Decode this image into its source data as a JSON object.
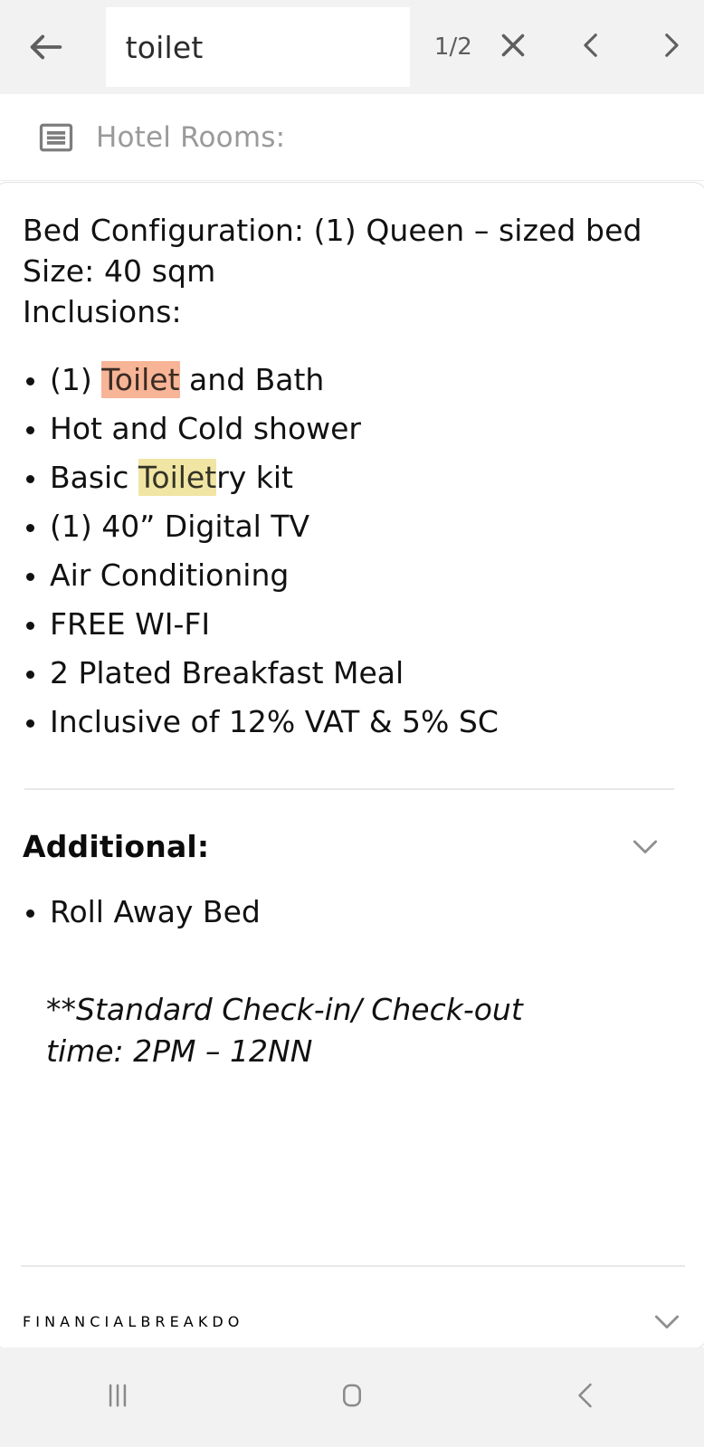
{
  "findbar": {
    "back_icon": "arrow-left-icon",
    "query_value": "toilet",
    "query_placeholder": "Search",
    "match_count": "1/2",
    "close_icon": "close-icon",
    "prev_icon": "chevron-left-icon",
    "next_icon": "chevron-right-icon"
  },
  "doc_header": {
    "icon": "article-list-icon",
    "title": "Hotel Rooms:"
  },
  "document": {
    "lines": [
      "Bed Configuration: (1) Queen – sized bed",
      "Size: 40 sqm",
      "Inclusions:"
    ],
    "inclusions": [
      {
        "pre": "(1) ",
        "highlight": "Toilet",
        "highlight_type": "active",
        "post": " and Bath"
      },
      {
        "pre": "Hot and Cold shower",
        "highlight": "",
        "highlight_type": "none",
        "post": ""
      },
      {
        "pre": "Basic ",
        "highlight": "Toilet",
        "highlight_type": "inactive",
        "post": "ry kit"
      },
      {
        "pre": "(1) 40” Digital TV",
        "highlight": "",
        "highlight_type": "none",
        "post": ""
      },
      {
        "pre": "Air Conditioning",
        "highlight": "",
        "highlight_type": "none",
        "post": ""
      },
      {
        "pre": "FREE WI-FI",
        "highlight": "",
        "highlight_type": "none",
        "post": ""
      },
      {
        "pre": "2 Plated Breakfast Meal",
        "highlight": "",
        "highlight_type": "none",
        "post": ""
      },
      {
        "pre": "Inclusive of 12% VAT & 5% SC",
        "highlight": "",
        "highlight_type": "none",
        "post": ""
      }
    ],
    "additional": {
      "heading": "Additional:",
      "collapse_icon": "chevron-down-icon",
      "items": [
        "Roll Away Bed"
      ],
      "note_line1": "**Standard Check-in/ Check-out",
      "note_line2": "time: 2PM – 12NN"
    },
    "financial": {
      "heading": "F I N A N C I A L B R E A K D O",
      "collapse_icon": "chevron-down-icon"
    }
  },
  "navbar": {
    "recents_icon": "recents-icon",
    "home_icon": "home-icon",
    "back_icon": "back-icon"
  },
  "colors": {
    "highlight_active": "#f7b496",
    "highlight_inactive": "#f1e5a4",
    "toolbar_bg": "#f2f2f2",
    "icon_gray": "#5f5f5f",
    "muted_text": "#9a9a9a"
  }
}
